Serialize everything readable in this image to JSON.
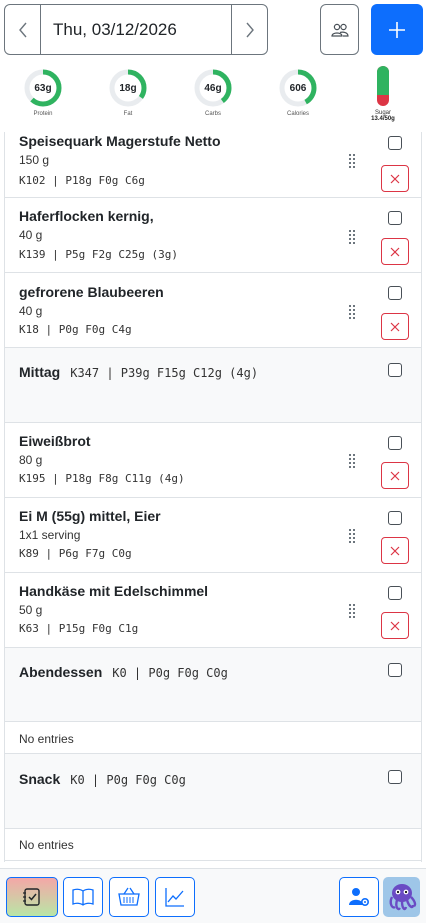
{
  "header": {
    "date": "Thu, 03/12/2026"
  },
  "macros": [
    {
      "value": "63g",
      "label": "Protein",
      "progress": 0.62,
      "color": "#2fb360"
    },
    {
      "value": "18g",
      "label": "Fat",
      "progress": 0.35,
      "color": "#2fb360"
    },
    {
      "value": "46g",
      "label": "Carbs",
      "progress": 0.4,
      "color": "#2fb360"
    },
    {
      "value": "606",
      "label": "Calories",
      "progress": 0.42,
      "color": "#2fb360"
    }
  ],
  "sugar": {
    "label": "Sugar",
    "value": "13.4/50g",
    "progress": 0.27
  },
  "entries": {
    "e1": {
      "name": "Speisequark Magerstufe Netto",
      "amount": "150 g",
      "macros": "K102 | P18g F0g C6g"
    },
    "e2": {
      "name": "Haferflocken kernig,",
      "amount": "40 g",
      "macros": "K139 | P5g F2g C25g (3g)"
    },
    "e3": {
      "name": "gefrorene Blaubeeren",
      "amount": "40 g",
      "macros": "K18 | P0g F0g C4g"
    },
    "mittag": {
      "name": "Mittag",
      "macros": "K347 | P39g F15g C12g (4g)"
    },
    "e4": {
      "name": "Eiweißbrot",
      "amount": "80 g",
      "macros": "K195 | P18g F8g C11g (4g)"
    },
    "e5": {
      "name": "Ei M (55g) mittel, Eier",
      "amount": "1x1 serving",
      "macros": "K89 | P6g F7g C0g"
    },
    "e6": {
      "name": "Handkäse mit Edelschimmel",
      "amount": "50 g",
      "macros": "K63 | P15g F0g C1g"
    },
    "abendessen": {
      "name": "Abendessen",
      "macros": "K0 | P0g F0g C0g",
      "empty": "No entries"
    },
    "snack": {
      "name": "Snack",
      "macros": "K0 | P0g F0g C0g",
      "empty": "No entries"
    }
  },
  "colors": {
    "primary": "#0d6efd",
    "danger": "#dc3545",
    "success": "#2fb360"
  },
  "bottom_nav": [
    "diary-icon",
    "book-icon",
    "basket-icon",
    "chart-icon",
    "user-settings-icon",
    "avatar"
  ]
}
